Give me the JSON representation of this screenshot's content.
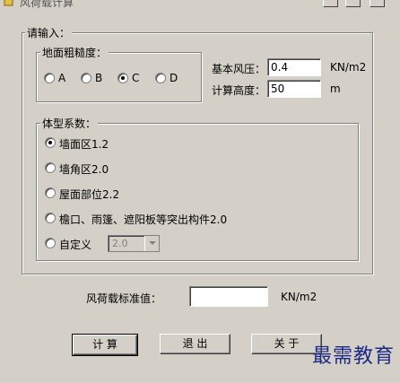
{
  "window": {
    "title": "风荷载计算"
  },
  "input_group": {
    "legend": "请输入："
  },
  "roughness": {
    "legend": "地面粗糙度：",
    "options": [
      {
        "label": "A",
        "checked": false
      },
      {
        "label": "B",
        "checked": false
      },
      {
        "label": "C",
        "checked": true
      },
      {
        "label": "D",
        "checked": false
      }
    ]
  },
  "basic_wind": {
    "label": "基本风压：",
    "value": "0.4",
    "unit": "KN/m2"
  },
  "height": {
    "label": "计算高度：",
    "value": "50",
    "unit": "m"
  },
  "shape": {
    "legend": "体型系数：",
    "options": [
      {
        "label": "墙面区1.2",
        "checked": true
      },
      {
        "label": "墙角区2.0",
        "checked": false
      },
      {
        "label": "屋面部位2.2",
        "checked": false
      },
      {
        "label": "檐口、雨篷、遮阳板等突出构件2.0",
        "checked": false
      },
      {
        "label": "自定义",
        "checked": false
      }
    ],
    "custom_value": "2.0"
  },
  "result": {
    "label": "风荷载标准值：",
    "value": "",
    "unit": "KN/m2"
  },
  "buttons": {
    "calc": "计 算",
    "exit": "退 出",
    "about": "关 于"
  },
  "watermark": "最需教育"
}
